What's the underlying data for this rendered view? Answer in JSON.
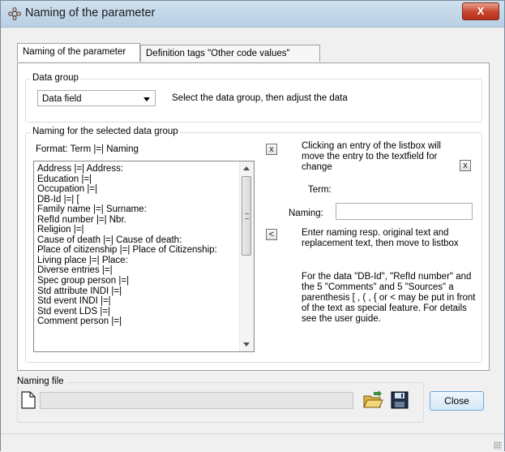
{
  "window": {
    "title": "Naming of the parameter",
    "close_glyph": "X"
  },
  "tabs": [
    {
      "label": "Naming of the parameter",
      "active": true
    },
    {
      "label": "Definition tags \"Other code values\"",
      "active": false
    }
  ],
  "data_group": {
    "label": "Data group",
    "selected": "Data field",
    "hint": "Select the data group, then adjust the data"
  },
  "naming_group": {
    "label": "Naming for the selected data group",
    "format": "Format: Term |=| Naming",
    "items": [
      "Address |=| Address:",
      "Education |=|",
      "Occupation |=|",
      "DB-Id |=| [",
      "Family name |=| Surname:",
      "RefId number |=| Nbr.",
      "Religion |=|",
      "Cause of death |=| Cause of death:",
      "Place of citizenship |=| Place of Citizenship:",
      "Living place |=| Place:",
      "Diverse entries |=|",
      "Spec group person |=|",
      "Std attribute INDI |=|",
      "Std event INDI |=|",
      "Std event LDS |=|",
      "Comment person |=|"
    ],
    "clear_list_glyph": "x",
    "move_left_glyph": "<",
    "clear_text_glyph": "x",
    "click_hint": "Clicking an entry of the listbox will move the entry to the textfield  for change",
    "term_label": "Term:",
    "naming_label": "Naming:",
    "naming_value": "",
    "enter_hint": "Enter naming resp. original text and replacement text, then move to listbox",
    "special_hint": "For the data \"DB-Id\", \"RefId number\" and the 5 \"Comments\" and 5 \"Sources\" a parenthesis [ , ( , { or < may be put in front of the text as special feature. For details see the user guide."
  },
  "naming_file": {
    "label": "Naming file",
    "path": ""
  },
  "buttons": {
    "close": "Close"
  },
  "icons": {
    "app": "gear-flower-icon",
    "new_file": "blank-document-icon",
    "open": "open-folder-icon",
    "save": "floppy-disk-icon"
  }
}
